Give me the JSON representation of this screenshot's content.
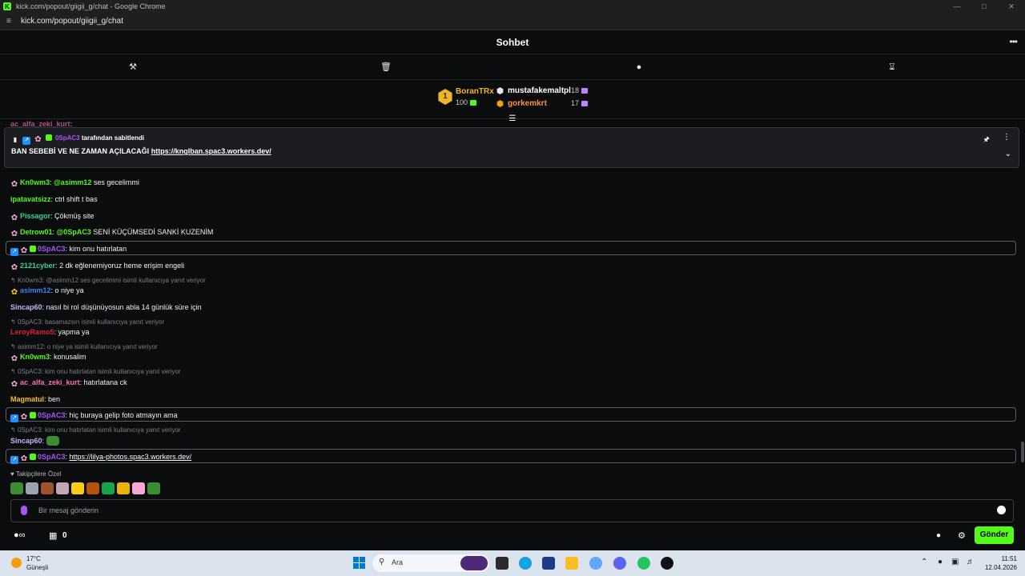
{
  "browser": {
    "window_title": "kick.com/popout/giigii_g/chat - Google Chrome",
    "url": "kick.com/popout/giigii_g/chat"
  },
  "chat_header": {
    "title": "Sohbet"
  },
  "leaderboard": {
    "first": {
      "rank": "1",
      "name": "BoranTRx",
      "value": "100"
    },
    "second": {
      "name": "mustafakemaltpl",
      "value": "18"
    },
    "third": {
      "name": "gorkemkrt",
      "value": "17"
    }
  },
  "pinned": {
    "pinned_by_user": "0SpAC3",
    "pinned_by_suffix": "tarafından sabitlendi",
    "text": "BAN SEBEBİ VE NE ZAMAN AÇILACAĞI",
    "link": "https://knglban.spac3.workers.dev/"
  },
  "overlap_top_user": "ac_alfa_zeki_kurt:",
  "messages": [
    {
      "user": "Kn0wm3",
      "mention": "@asimm12",
      "text": "ses gecelimmi"
    },
    {
      "user": "ipatavatsizz",
      "text": "ctrl shift t bas"
    },
    {
      "user": "Pissagor",
      "text": "Çökmüş site"
    },
    {
      "user": "Detrow01",
      "mention": "@0SpAC3",
      "text": "SENİ KÜÇÜMSEDİ SANKİ KUZENİM"
    },
    {
      "user": "0SpAC3",
      "text": "kim onu hatırlatan"
    },
    {
      "user": "2121cyber",
      "text": "2 dk eğlenemiyoruz heme erişim engeli"
    },
    {
      "reply": "Kn0wm3: @asimm12 ses gecelimmi isimli kullanıcıya yanıt veriyor",
      "user": "asimm12",
      "text": "o niye ya"
    },
    {
      "user": "Sincap60",
      "text": "nasıl bi rol düşünüyosun abla 14 günlük süre için"
    },
    {
      "reply": "0SpAC3: basamazsın isimli kullanıcıya yanıt veriyor",
      "user": "LeroyRamo5",
      "text": "yapma ya"
    },
    {
      "reply": "asimm12: o niye ya isimli kullanıcıya yanıt veriyor",
      "user": "Kn0wm3",
      "text": "konusalim"
    },
    {
      "reply": "0SpAC3: kim onu hatırlatan isimli kullanıcıya yanıt veriyor",
      "user": "ac_alfa_zeki_kurt",
      "text": "hatırlatana ck"
    },
    {
      "user": "Magmatul",
      "text": "ben"
    },
    {
      "user": "0SpAC3",
      "text": "hiç buraya gelip foto atmayın ama"
    },
    {
      "reply": "0SpAC3: kim onu hatırlatan isimli kullanıcıya yanıt veriyor",
      "user": "Sincap60",
      "text": ""
    },
    {
      "user": "0SpAC3",
      "link": "https://lilya-photos.spac3.workers.dev/"
    }
  ],
  "followers_label": "Takipçilere Özel",
  "input": {
    "placeholder": "Bir mesaj gönderin"
  },
  "bottom": {
    "viewer_count": "0",
    "send_label": "Gönder"
  },
  "taskbar": {
    "temperature": "17°C",
    "condition": "Güneşli",
    "search_label": "Ara",
    "time": "11:51",
    "date": "12.04.2026"
  },
  "colors": {
    "accent": "#53fc18",
    "gold": "#f0b429",
    "vip_purple": "#a855f7",
    "link": "#ffffff"
  }
}
